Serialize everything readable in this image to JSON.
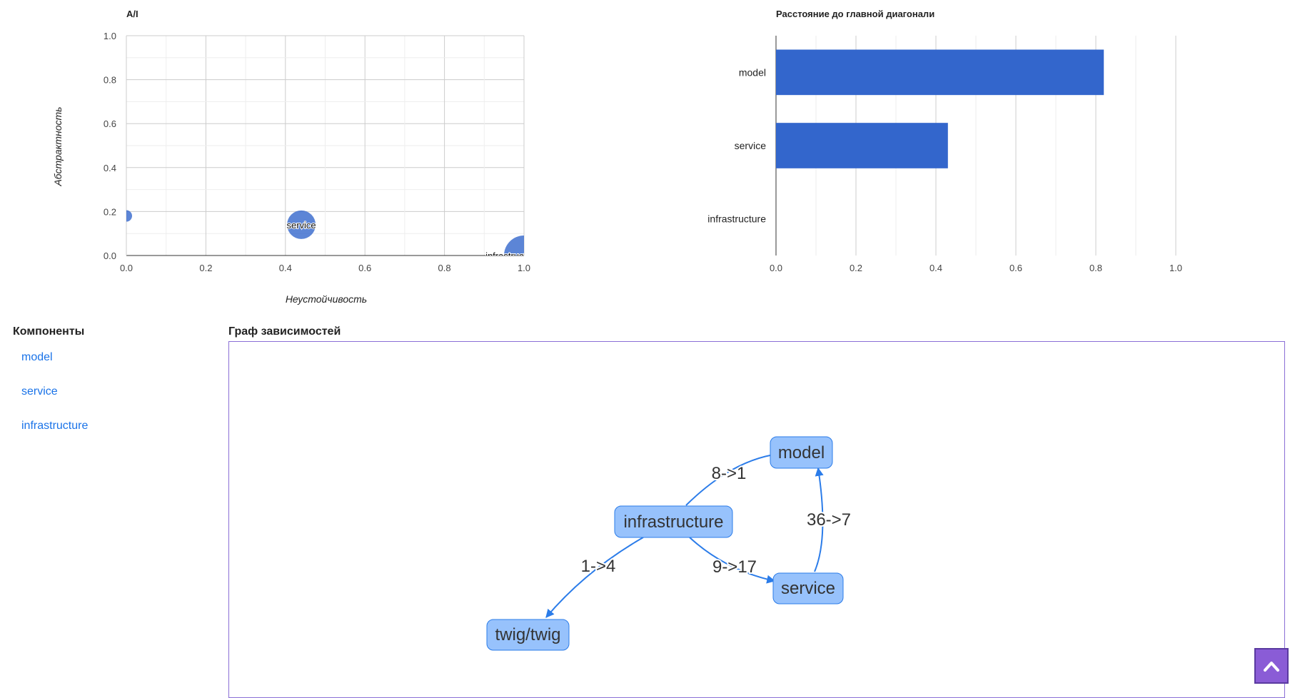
{
  "chart_data": [
    {
      "type": "scatter",
      "title": "A/I",
      "xlabel": "Неустойчивость",
      "ylabel": "Абстрактность",
      "xlim": [
        0,
        1
      ],
      "ylim": [
        0,
        1
      ],
      "xticks": [
        "0.0",
        "0.2",
        "0.4",
        "0.6",
        "0.8",
        "1.0"
      ],
      "yticks": [
        "0.0",
        "0.2",
        "0.4",
        "0.6",
        "0.8",
        "1.0"
      ],
      "grid": true,
      "points": [
        {
          "label": "model",
          "x": 0.0,
          "y": 0.18,
          "size": 1
        },
        {
          "label": "service",
          "x": 0.44,
          "y": 0.14,
          "size": 4
        },
        {
          "label": "infrastructure",
          "x": 1.0,
          "y": 0.0,
          "size": 6
        }
      ]
    },
    {
      "type": "bar",
      "orientation": "horizontal",
      "title": "Расстояние до главной диагонали",
      "categories": [
        "model",
        "service",
        "infrastructure"
      ],
      "values": [
        0.82,
        0.43,
        0.0
      ],
      "xlim": [
        0,
        1.0
      ],
      "xticks": [
        "0.0",
        "0.2",
        "0.4",
        "0.6",
        "0.8",
        "1.0"
      ],
      "grid": true,
      "color": "#3366cc"
    }
  ],
  "components": {
    "title": "Компоненты",
    "items": [
      "model",
      "service",
      "infrastructure"
    ]
  },
  "graph": {
    "title": "Граф зависимостей",
    "nodes": [
      "model",
      "infrastructure",
      "service",
      "twig/twig"
    ],
    "edges": [
      {
        "from": "infrastructure",
        "to": "model",
        "label": "8->1"
      },
      {
        "from": "service",
        "to": "model",
        "label": "36->7"
      },
      {
        "from": "infrastructure",
        "to": "twig/twig",
        "label": "1->4"
      },
      {
        "from": "infrastructure",
        "to": "service",
        "label": "9->17"
      }
    ],
    "colors": {
      "node_fill": "#97c2fc",
      "node_border": "#2b7ce9",
      "edge": "#2b7ce9"
    }
  },
  "scroll_top_icon": "chevron-up-icon"
}
